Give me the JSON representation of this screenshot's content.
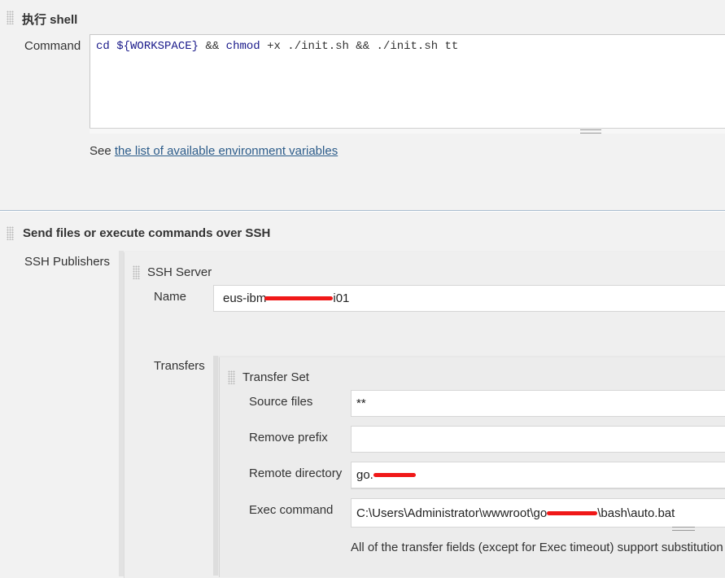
{
  "shell_section": {
    "title": "执行 shell",
    "command_label": "Command",
    "command_value_parts": {
      "cd": "cd",
      "workspace": "${WORKSPACE}",
      "and1": "&&",
      "chmod": "chmod",
      "rest": "+x ./init.sh && ./init.sh tt"
    },
    "see_text": "See",
    "env_link": "the list of available environment variables"
  },
  "ssh_section": {
    "title": "Send files or execute commands over SSH",
    "publishers_label": "SSH Publishers",
    "server": {
      "title": "SSH Server",
      "name_label": "Name",
      "name_value_prefix": "eus-ibm",
      "name_value_suffix": "i01",
      "transfers_label": "Transfers",
      "transfer_set": {
        "title": "Transfer Set",
        "source_files_label": "Source files",
        "source_files_value": "**",
        "remove_prefix_label": "Remove prefix",
        "remove_prefix_value": "",
        "remote_directory_label": "Remote directory",
        "remote_directory_prefix": "go.",
        "exec_command_label": "Exec command",
        "exec_command_prefix": "C:\\Users\\Administrator\\wwwroot\\go",
        "exec_command_suffix": "\\bash\\auto.bat",
        "note": "All of the transfer fields (except for Exec timeout) support substitution"
      }
    }
  },
  "colors": {
    "background": "#f2f2f2",
    "link": "#2c5c8a",
    "redaction": "#f01818",
    "divider": "#a9bccf"
  }
}
